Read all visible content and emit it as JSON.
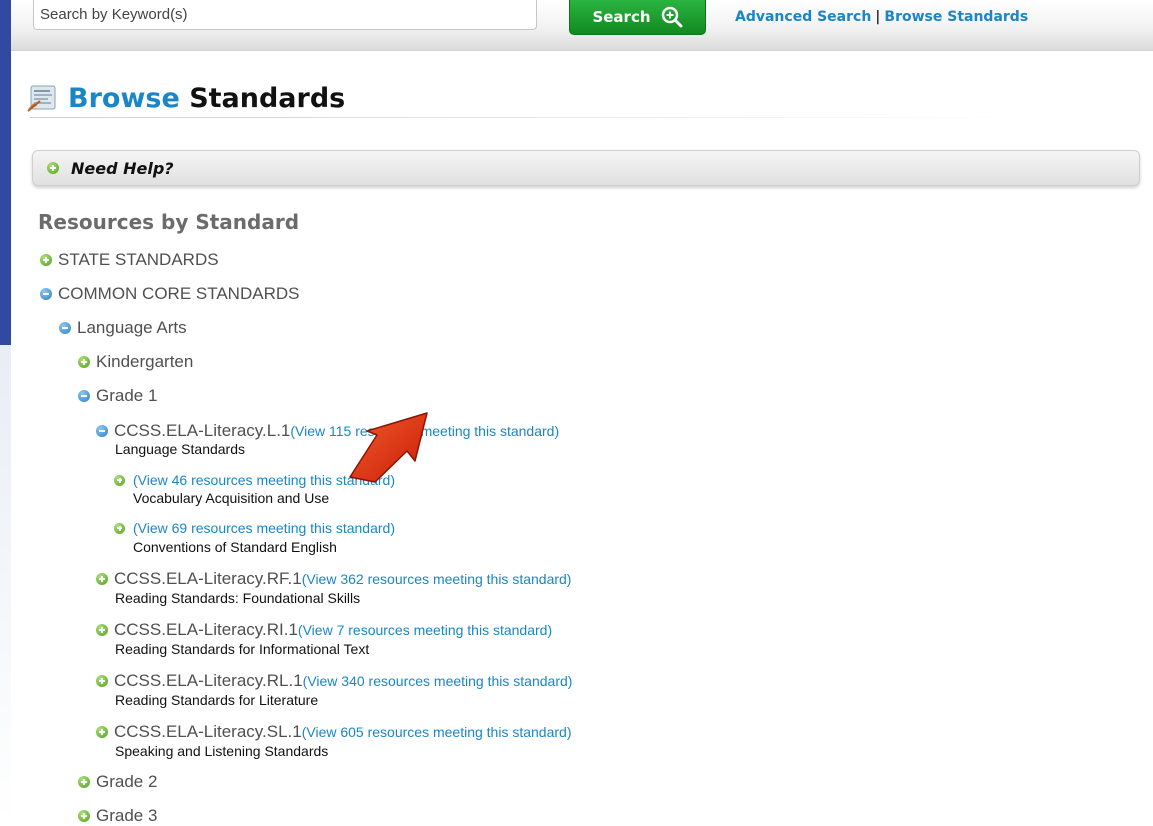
{
  "search": {
    "placeholder": "Search by Keyword(s)",
    "button_label": "Search",
    "advanced_link": "Advanced Search",
    "separator": "|",
    "browse_link": "Browse Standards"
  },
  "page": {
    "title_part1": "Browse",
    "title_part2": "Standards"
  },
  "help": {
    "label": "Need Help?"
  },
  "resources": {
    "title": "Resources by Standard",
    "state_standards": "STATE STANDARDS",
    "common_core": "COMMON CORE STANDARDS",
    "language_arts": "Language Arts",
    "kindergarten": "Kindergarten",
    "grade1": "Grade 1",
    "l1": {
      "code": "CCSS.ELA-Literacy.L.1",
      "link": "(View 115 resources meeting this standard)",
      "desc": "Language Standards",
      "children": [
        {
          "link": "(View 46 resources meeting this standard)",
          "desc": "Vocabulary Acquisition and Use"
        },
        {
          "link": "(View 69 resources meeting this standard)",
          "desc": "Conventions of Standard English"
        }
      ]
    },
    "standards": [
      {
        "code": "CCSS.ELA-Literacy.RF.1",
        "link": "(View 362 resources meeting this standard)",
        "desc": "Reading Standards: Foundational Skills"
      },
      {
        "code": "CCSS.ELA-Literacy.RI.1",
        "link": "(View 7 resources meeting this standard)",
        "desc": "Reading Standards for Informational Text"
      },
      {
        "code": "CCSS.ELA-Literacy.RL.1",
        "link": "(View 340 resources meeting this standard)",
        "desc": "Reading Standards for Literature"
      },
      {
        "code": "CCSS.ELA-Literacy.SL.1",
        "link": "(View 605 resources meeting this standard)",
        "desc": "Speaking and Listening Standards"
      }
    ],
    "grade2": "Grade 2",
    "grade3": "Grade 3"
  },
  "colors": {
    "accent_blue": "#1a86c6",
    "search_green": "#1a9e2e",
    "annotation_red": "#e02a12",
    "sidebar_blue": "#2f4aa0"
  }
}
